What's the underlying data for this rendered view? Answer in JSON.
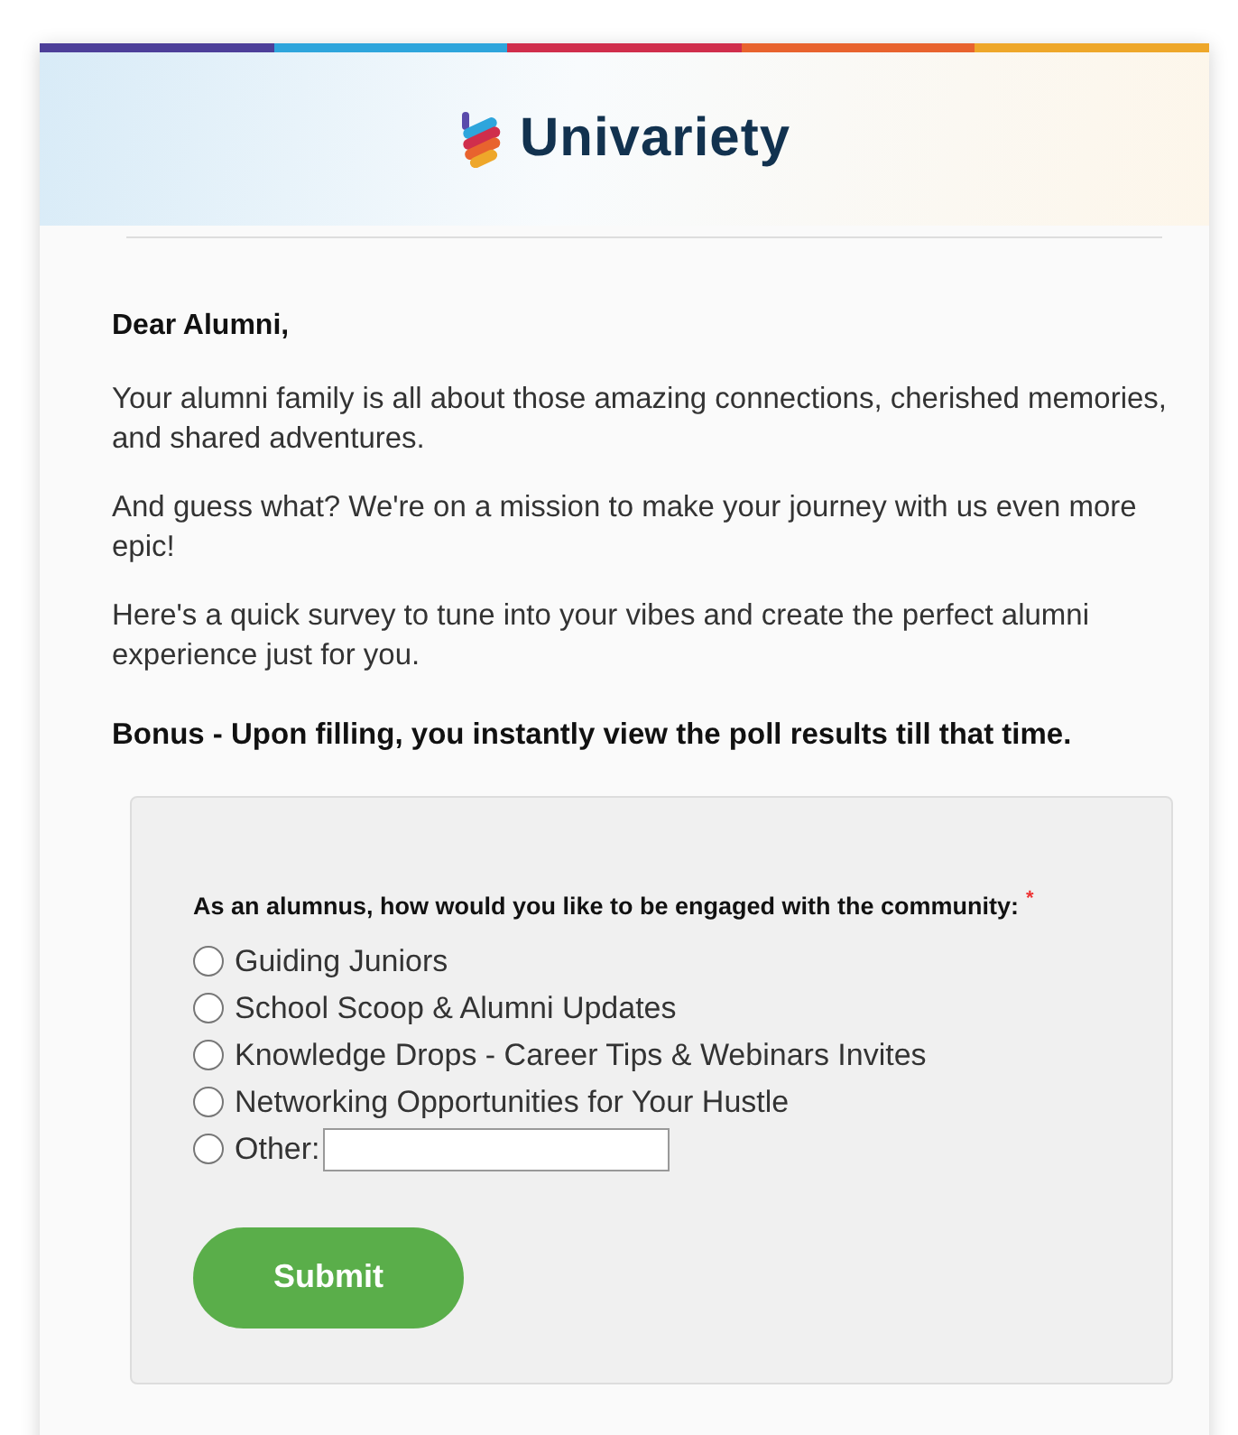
{
  "header": {
    "logo_text": "Univariety"
  },
  "greeting": "Dear Alumni,",
  "paragraphs": [
    "Your alumni family is all about those amazing connections, cherished memories, and shared adventures.",
    "And guess what? We're on a mission to make your journey with us even more epic!",
    "Here's a quick survey to tune into your vibes and create the perfect alumni experience just for you."
  ],
  "bonus": "Bonus - Upon filling, you instantly view the poll results till that time.",
  "survey": {
    "question": "As an alumnus, how would you like to be engaged with the community:",
    "required_mark": "*",
    "options": [
      {
        "label": "Guiding Juniors",
        "kind": "plain",
        "selected": false
      },
      {
        "label": "School Scoop & Alumni Updates",
        "kind": "plain",
        "selected": false
      },
      {
        "label": "Knowledge Drops - Career Tips & Webinars Invites",
        "kind": "plain",
        "selected": false
      },
      {
        "label": "Networking Opportunities for Your Hustle",
        "kind": "plain",
        "selected": false
      },
      {
        "label": "Other:",
        "kind": "other",
        "selected": false
      }
    ],
    "submit": "Submit"
  }
}
